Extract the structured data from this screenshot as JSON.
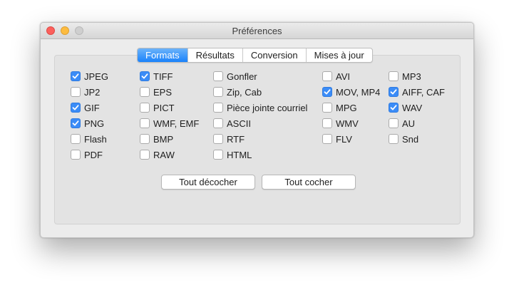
{
  "window": {
    "title": "Préférences"
  },
  "tabs": [
    {
      "label": "Formats",
      "active": true
    },
    {
      "label": "Résultats",
      "active": false
    },
    {
      "label": "Conversion",
      "active": false
    },
    {
      "label": "Mises à jour",
      "active": false
    }
  ],
  "columns": [
    [
      {
        "label": "JPEG",
        "checked": true
      },
      {
        "label": "JP2",
        "checked": false
      },
      {
        "label": "GIF",
        "checked": true
      },
      {
        "label": "PNG",
        "checked": true
      },
      {
        "label": "Flash",
        "checked": false
      },
      {
        "label": "PDF",
        "checked": false
      }
    ],
    [
      {
        "label": "TIFF",
        "checked": true
      },
      {
        "label": "EPS",
        "checked": false
      },
      {
        "label": "PICT",
        "checked": false
      },
      {
        "label": "WMF, EMF",
        "checked": false
      },
      {
        "label": "BMP",
        "checked": false
      },
      {
        "label": "RAW",
        "checked": false
      }
    ],
    [
      {
        "label": "Gonfler",
        "checked": false
      },
      {
        "label": "Zip, Cab",
        "checked": false
      },
      {
        "label": "Pièce jointe courriel",
        "checked": false
      },
      {
        "label": "ASCII",
        "checked": false
      },
      {
        "label": "RTF",
        "checked": false
      },
      {
        "label": "HTML",
        "checked": false
      }
    ],
    [
      {
        "label": "AVI",
        "checked": false
      },
      {
        "label": "MOV, MP4",
        "checked": true
      },
      {
        "label": "MPG",
        "checked": false
      },
      {
        "label": "WMV",
        "checked": false
      },
      {
        "label": "FLV",
        "checked": false
      }
    ],
    [
      {
        "label": "MP3",
        "checked": false
      },
      {
        "label": "AIFF, CAF",
        "checked": true
      },
      {
        "label": "WAV",
        "checked": true
      },
      {
        "label": "AU",
        "checked": false
      },
      {
        "label": "Snd",
        "checked": false
      }
    ]
  ],
  "buttons": {
    "uncheck_all": "Tout décocher",
    "check_all": "Tout cocher"
  },
  "colors": {
    "accent": "#3b8cf7",
    "close": "#fc605c",
    "minimize": "#fdbc40",
    "zoom_disabled": "#cfcfcf"
  }
}
